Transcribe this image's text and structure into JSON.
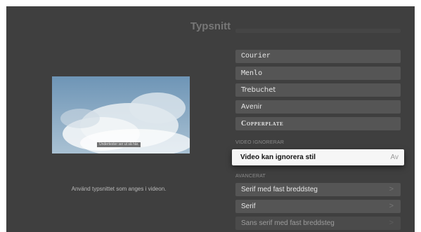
{
  "screen": {
    "title": "Typsnitt"
  },
  "preview": {
    "subtitle_sample": "Undertexter ser ut så här.",
    "help_text": "Använd typsnittet som anges i videon."
  },
  "fonts": [
    {
      "label": "Courier"
    },
    {
      "label": "Menlo"
    },
    {
      "label": "Trebuchet"
    },
    {
      "label": "Avenir"
    },
    {
      "label": "Copperplate"
    }
  ],
  "video_overrides": {
    "header": "VIDEO IGNORERAR",
    "label": "Video kan ignorera stil",
    "value": "Av"
  },
  "advanced": {
    "header": "AVANCERAT",
    "items": [
      {
        "label": "Serif med fast breddsteg",
        "icon": "chevron-right-icon"
      },
      {
        "label": "Serif",
        "icon": "chevron-right-icon"
      },
      {
        "label": "Sans serif med fast breddsteg",
        "icon": "chevron-right-icon"
      }
    ]
  },
  "colors": {
    "background": "#3f3f3f",
    "item_background": "#555555",
    "focused_background": "#f6f6f6",
    "sky": "#7da2bf"
  }
}
